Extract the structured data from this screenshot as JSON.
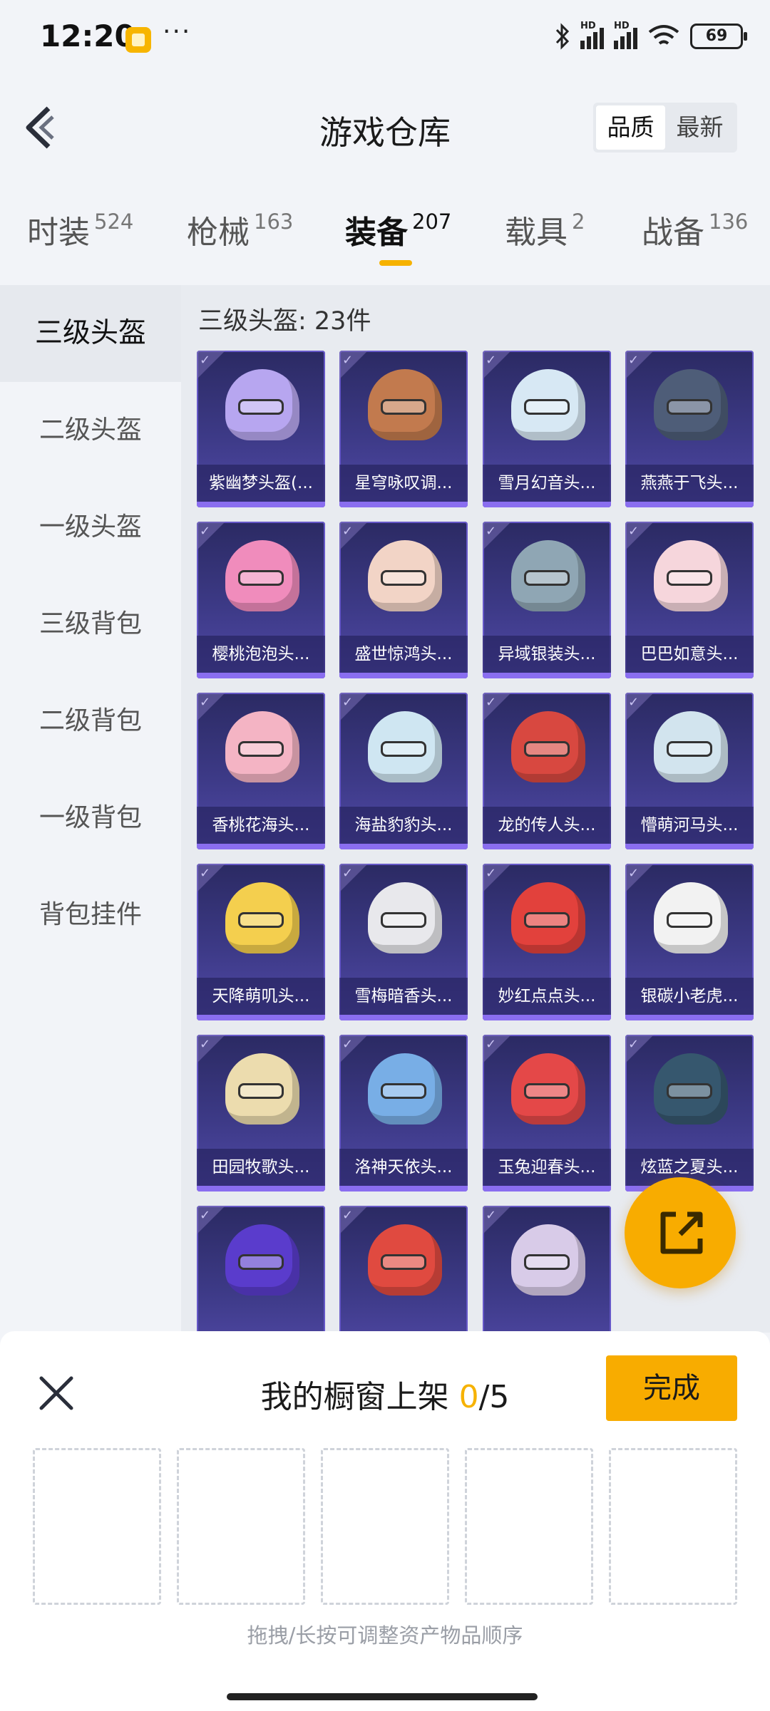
{
  "status_bar": {
    "time": "12:20",
    "more": "···",
    "battery": "69",
    "hd": "HD"
  },
  "header": {
    "title": "游戏仓库",
    "sort_options": [
      "品质",
      "最新"
    ],
    "active_sort": "品质"
  },
  "tabs": [
    {
      "label": "时装",
      "count": "524"
    },
    {
      "label": "枪械",
      "count": "163"
    },
    {
      "label": "装备",
      "count": "207",
      "active": true
    },
    {
      "label": "载具",
      "count": "2"
    },
    {
      "label": "战备",
      "count": "136"
    }
  ],
  "categories": [
    {
      "label": "三级头盔",
      "active": true
    },
    {
      "label": "二级头盔"
    },
    {
      "label": "一级头盔"
    },
    {
      "label": "三级背包"
    },
    {
      "label": "二级背包"
    },
    {
      "label": "一级背包"
    },
    {
      "label": "背包挂件"
    }
  ],
  "section_title": "三级头盔: 23件",
  "items": [
    {
      "name": "紫幽梦头盔(...",
      "color": "#b7a6f0"
    },
    {
      "name": "星穹咏叹调...",
      "color": "#c27a4e"
    },
    {
      "name": "雪月幻音头...",
      "color": "#d7e8f4"
    },
    {
      "name": "燕燕于飞头...",
      "color": "#4e5d78"
    },
    {
      "name": "樱桃泡泡头...",
      "color": "#f08cbc"
    },
    {
      "name": "盛世惊鸿头...",
      "color": "#f2d4c6"
    },
    {
      "name": "异域银装头...",
      "color": "#8fa6b4"
    },
    {
      "name": "巴巴如意头...",
      "color": "#f6d6dc"
    },
    {
      "name": "香桃花海头...",
      "color": "#f4b4c4"
    },
    {
      "name": "海盐豹豹头...",
      "color": "#cfe6f2"
    },
    {
      "name": "龙的传人头...",
      "color": "#d84840"
    },
    {
      "name": "懵萌河马头...",
      "color": "#d2e4ee"
    },
    {
      "name": "天降萌叽头...",
      "color": "#f4cf4e"
    },
    {
      "name": "雪梅暗香头...",
      "color": "#e8e8ec"
    },
    {
      "name": "妙红点点头...",
      "color": "#e2413c"
    },
    {
      "name": "银碳小老虎...",
      "color": "#f2f2f2"
    },
    {
      "name": "田园牧歌头...",
      "color": "#ecdcae"
    },
    {
      "name": "洛神天依头...",
      "color": "#78aee6"
    },
    {
      "name": "玉兔迎春头...",
      "color": "#e44848"
    },
    {
      "name": "炫蓝之夏头...",
      "color": "#36576e"
    },
    {
      "name": "",
      "color": "#5a3ccc"
    },
    {
      "name": "",
      "color": "#e04a40"
    },
    {
      "name": "",
      "color": "#d8cbe8"
    }
  ],
  "sheet": {
    "title_prefix": "我的橱窗上架 ",
    "used": "0",
    "total": "/5",
    "done": "完成",
    "hint": "拖拽/长按可调整资产物品顺序"
  },
  "colors": {
    "accent": "#f8ac00",
    "card_bg": "#3d3a87"
  }
}
